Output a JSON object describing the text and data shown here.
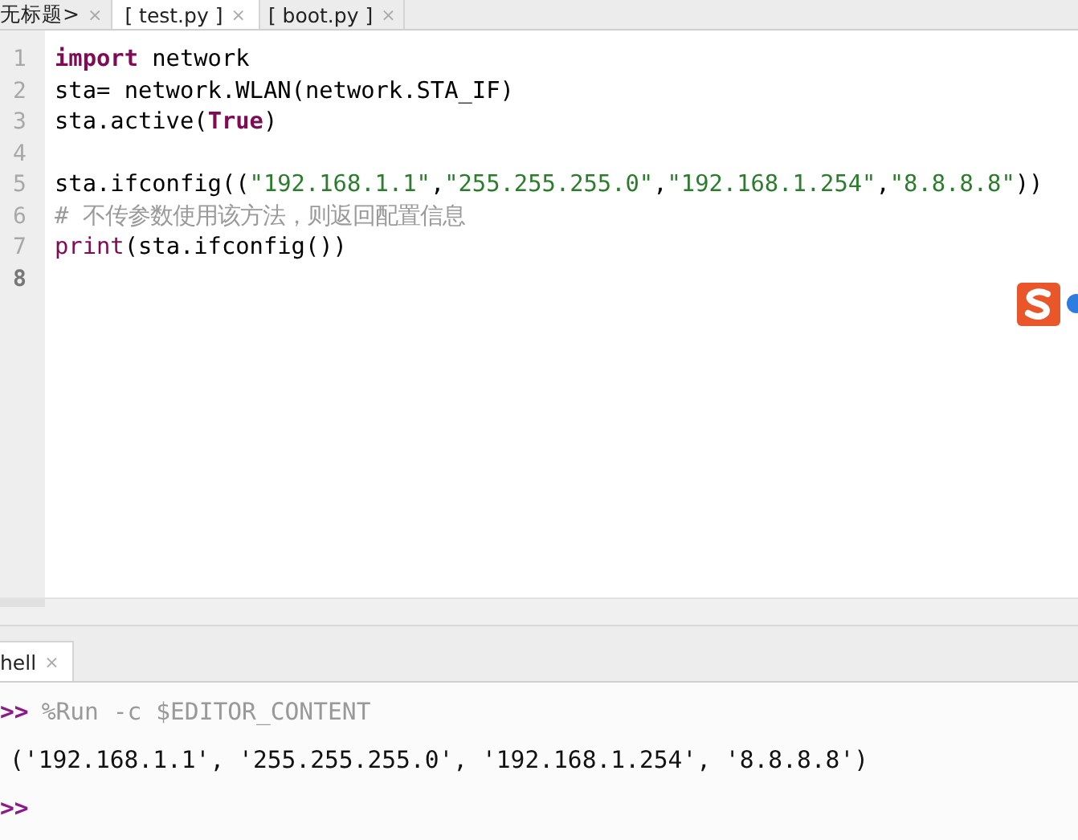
{
  "editor_tabs": [
    {
      "label": "无标题>",
      "close": "×",
      "selected": false
    },
    {
      "label": "[ test.py ]",
      "close": "×",
      "selected": true
    },
    {
      "label": "[ boot.py ]",
      "close": "×",
      "selected": false
    }
  ],
  "editor": {
    "lines": [
      {
        "number": "1",
        "current": false,
        "tokens": [
          {
            "kind": "keyword",
            "text": "import"
          },
          {
            "kind": "plain",
            "text": " network"
          }
        ]
      },
      {
        "number": "2",
        "current": false,
        "tokens": [
          {
            "kind": "plain",
            "text": "sta= network.WLAN(network.STA_IF)"
          }
        ]
      },
      {
        "number": "3",
        "current": false,
        "tokens": [
          {
            "kind": "plain",
            "text": "sta.active("
          },
          {
            "kind": "keyword",
            "text": "True"
          },
          {
            "kind": "plain",
            "text": ")"
          }
        ]
      },
      {
        "number": "4",
        "current": false
      },
      {
        "number": "5",
        "current": false,
        "tokens": [
          {
            "kind": "plain",
            "text": "sta.ifconfig(("
          },
          {
            "kind": "string",
            "text": "\"192.168.1.1\""
          },
          {
            "kind": "plain",
            "text": ","
          },
          {
            "kind": "string",
            "text": "\"255.255.255.0\""
          },
          {
            "kind": "plain",
            "text": ","
          },
          {
            "kind": "string",
            "text": "\"192.168.1.254\""
          },
          {
            "kind": "plain",
            "text": ","
          },
          {
            "kind": "string",
            "text": "\"8.8.8.8\""
          },
          {
            "kind": "plain",
            "text": "))"
          }
        ]
      },
      {
        "number": "6",
        "current": false,
        "tokens": [
          {
            "kind": "comment",
            "text": "# 不传参数使用该方法，则返回配置信息"
          }
        ]
      },
      {
        "number": "7",
        "current": false,
        "tokens": [
          {
            "kind": "builtin",
            "text": "print"
          },
          {
            "kind": "plain",
            "text": "(sta.ifconfig())"
          }
        ]
      },
      {
        "number": "8",
        "current": true
      }
    ]
  },
  "shell_tab": {
    "label": "hell",
    "close": "×",
    "selected": true
  },
  "shell": {
    "lines": [
      {
        "kind": "command",
        "prompt": ">>",
        "text": "%Run -c $EDITOR_CONTENT"
      },
      {
        "kind": "output",
        "text": "('192.168.1.1', '255.255.255.0', '192.168.1.254', '8.8.8.8')"
      },
      {
        "kind": "command",
        "prompt": ">>"
      }
    ]
  }
}
